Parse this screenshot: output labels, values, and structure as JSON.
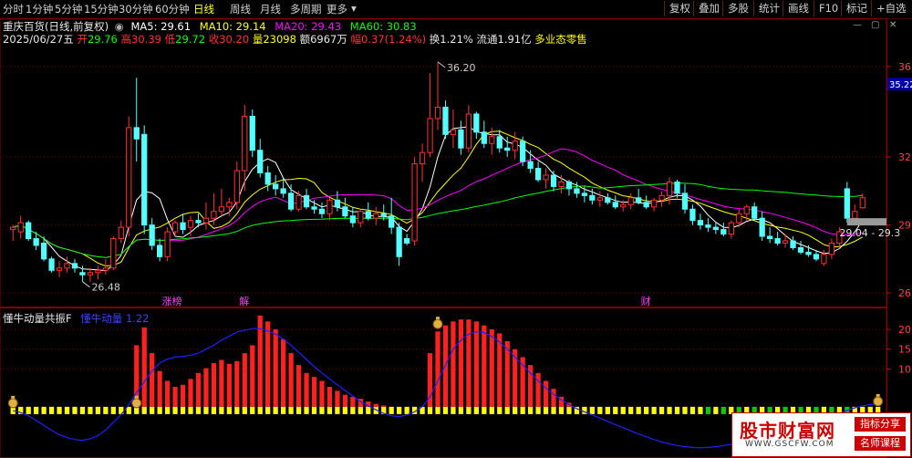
{
  "toolbar": {
    "timeframes": [
      "分时",
      "1分钟",
      "5分钟",
      "15分钟",
      "30分钟",
      "60分钟",
      "日线",
      "周线",
      "月线",
      "多周期",
      "更多"
    ],
    "active": "日线",
    "right_buttons": [
      "复权",
      "叠加",
      "多股",
      "统计",
      "画线",
      "F10",
      "标记",
      "+自选"
    ],
    "icons": [
      "minus-icon",
      "restore-icon",
      "close-icon"
    ]
  },
  "stock": {
    "name": "重庆百货(日线,前复权)",
    "ma5": "MA5: 29.61",
    "ma10": "MA10: 29.14",
    "ma20": "MA20: 29.43",
    "ma60": "MA60: 30.83",
    "date": "2025/06/27五",
    "open_lbl": "开",
    "open": "29.76",
    "high_lbl": "高",
    "high": "30.39",
    "low_lbl": "低",
    "low": "29.72",
    "close_lbl": "收",
    "close": "30.20",
    "vol_lbl": "量",
    "vol": "23098",
    "amt_lbl": "额",
    "amt": "6967万",
    "chg_lbl": "幅",
    "chg": "0.37(1.24%)",
    "turn": "换1.21%",
    "float": "流通1.91亿",
    "sector": "多业态零售"
  },
  "colors": {
    "up": "#ff3232",
    "down": "#54ffff",
    "ma5": "#ffffff",
    "ma10": "#ffff00",
    "ma20": "#ff00ff",
    "ma60": "#00ff00",
    "grid": "#800000",
    "sub_bar": "#ff2020",
    "sub_line": "#2020ff",
    "sub_base": "#ffff00"
  },
  "chart_data": [
    {
      "type": "candlestick",
      "y_ticks": [
        "36",
        "32",
        "29",
        "26"
      ],
      "ylim": [
        25.4,
        37.0
      ],
      "price_tag": "35.22",
      "annotations": {
        "high": "36.20",
        "low": "26.48",
        "range_label": "29.04 - 29.3"
      },
      "event_labels": [
        "涨榜",
        "解",
        "财"
      ],
      "candles": [
        [
          28.8,
          29.0,
          28.3,
          28.9
        ],
        [
          28.7,
          29.4,
          28.4,
          29.1
        ],
        [
          29.1,
          29.2,
          28.3,
          28.4
        ],
        [
          28.4,
          28.7,
          27.9,
          28.1
        ],
        [
          28.2,
          28.5,
          27.4,
          27.5
        ],
        [
          27.5,
          27.6,
          26.9,
          27.0
        ],
        [
          27.0,
          27.4,
          26.7,
          27.1
        ],
        [
          27.1,
          27.6,
          26.9,
          27.3
        ],
        [
          27.3,
          27.5,
          26.9,
          27.1
        ],
        [
          26.9,
          27.2,
          26.5,
          26.8
        ],
        [
          26.8,
          27.1,
          26.5,
          26.9
        ],
        [
          26.9,
          27.2,
          26.6,
          27.0
        ],
        [
          27.0,
          27.5,
          26.8,
          27.1
        ],
        [
          27.1,
          28.5,
          27.0,
          28.4
        ],
        [
          28.4,
          29.2,
          28.2,
          28.9
        ],
        [
          28.9,
          33.8,
          28.5,
          33.3
        ],
        [
          33.3,
          35.5,
          31.8,
          32.8
        ],
        [
          33.0,
          33.4,
          28.6,
          29.0
        ],
        [
          29.0,
          29.3,
          27.9,
          28.1
        ],
        [
          28.1,
          28.4,
          27.4,
          27.6
        ],
        [
          27.6,
          28.9,
          27.4,
          28.7
        ],
        [
          28.7,
          29.2,
          28.5,
          29.1
        ],
        [
          29.1,
          29.5,
          28.6,
          28.8
        ],
        [
          28.9,
          29.4,
          28.5,
          29.2
        ],
        [
          29.2,
          29.5,
          28.9,
          29.1
        ],
        [
          29.1,
          30.0,
          28.8,
          29.3
        ],
        [
          29.3,
          30.4,
          29.0,
          29.6
        ],
        [
          29.6,
          30.6,
          29.4,
          29.8
        ],
        [
          29.8,
          30.2,
          29.4,
          30.0
        ],
        [
          30.0,
          31.8,
          29.7,
          31.4
        ],
        [
          31.4,
          34.3,
          30.5,
          33.8
        ],
        [
          33.8,
          34.1,
          32.0,
          32.3
        ],
        [
          32.3,
          32.8,
          31.1,
          31.3
        ],
        [
          31.3,
          31.6,
          30.5,
          30.8
        ],
        [
          30.8,
          31.2,
          30.3,
          30.6
        ],
        [
          30.6,
          31.1,
          30.2,
          30.4
        ],
        [
          30.4,
          30.8,
          29.6,
          29.7
        ],
        [
          29.7,
          30.5,
          29.6,
          30.3
        ],
        [
          30.3,
          30.6,
          29.7,
          29.8
        ],
        [
          29.8,
          30.1,
          29.5,
          29.7
        ],
        [
          29.7,
          30.0,
          29.3,
          29.5
        ],
        [
          29.5,
          30.2,
          29.2,
          30.1
        ],
        [
          30.1,
          30.5,
          29.6,
          29.8
        ],
        [
          29.8,
          30.2,
          29.3,
          29.4
        ],
        [
          29.4,
          29.8,
          28.9,
          29.1
        ],
        [
          29.1,
          29.7,
          28.9,
          29.6
        ],
        [
          29.6,
          30.0,
          29.2,
          29.3
        ],
        [
          29.3,
          29.8,
          29.0,
          29.5
        ],
        [
          29.5,
          29.9,
          29.2,
          29.4
        ],
        [
          29.4,
          30.2,
          28.6,
          28.9
        ],
        [
          28.9,
          29.1,
          27.2,
          27.6
        ],
        [
          28.4,
          28.6,
          28.1,
          28.2
        ],
        [
          28.3,
          32.0,
          28.1,
          31.7
        ],
        [
          31.7,
          32.6,
          30.9,
          32.2
        ],
        [
          32.2,
          35.7,
          32.0,
          33.7
        ],
        [
          33.7,
          36.2,
          33.2,
          34.2
        ],
        [
          34.2,
          34.5,
          32.8,
          33.0
        ],
        [
          33.0,
          34.1,
          32.4,
          33.2
        ],
        [
          33.2,
          33.6,
          32.1,
          32.4
        ],
        [
          32.4,
          34.3,
          32.2,
          33.9
        ],
        [
          33.9,
          34.0,
          32.8,
          33.1
        ],
        [
          33.1,
          33.6,
          32.4,
          32.6
        ],
        [
          32.6,
          33.3,
          32.1,
          32.9
        ],
        [
          32.9,
          33.2,
          32.2,
          32.4
        ],
        [
          32.4,
          32.9,
          32.0,
          32.3
        ],
        [
          32.3,
          33.1,
          31.9,
          32.7
        ],
        [
          32.7,
          32.9,
          31.6,
          31.8
        ],
        [
          31.8,
          32.3,
          31.3,
          31.5
        ],
        [
          31.5,
          31.8,
          30.9,
          31.0
        ],
        [
          31.0,
          31.5,
          30.6,
          31.2
        ],
        [
          31.2,
          31.4,
          30.5,
          30.7
        ],
        [
          30.7,
          31.2,
          30.4,
          30.9
        ],
        [
          30.9,
          31.0,
          30.3,
          30.6
        ],
        [
          30.6,
          30.9,
          30.2,
          30.4
        ],
        [
          30.4,
          30.7,
          30.0,
          30.3
        ],
        [
          30.3,
          30.6,
          29.9,
          30.1
        ],
        [
          30.1,
          30.5,
          29.8,
          30.2
        ],
        [
          30.2,
          30.4,
          29.9,
          30.0
        ],
        [
          30.0,
          30.3,
          29.7,
          29.8
        ],
        [
          29.8,
          30.1,
          29.6,
          29.9
        ],
        [
          29.9,
          30.4,
          29.7,
          30.2
        ],
        [
          30.2,
          30.6,
          29.9,
          30.0
        ],
        [
          30.0,
          30.3,
          29.7,
          29.8
        ],
        [
          29.8,
          30.2,
          29.6,
          30.1
        ],
        [
          30.1,
          30.5,
          29.8,
          30.3
        ],
        [
          30.3,
          31.1,
          29.9,
          30.9
        ],
        [
          30.9,
          31.0,
          30.2,
          30.4
        ],
        [
          30.4,
          30.8,
          29.5,
          29.7
        ],
        [
          29.7,
          29.9,
          29.0,
          29.2
        ],
        [
          29.2,
          29.5,
          28.8,
          29.0
        ],
        [
          29.0,
          29.3,
          28.7,
          28.9
        ],
        [
          28.9,
          29.1,
          28.6,
          28.8
        ],
        [
          28.8,
          29.1,
          28.5,
          28.6
        ],
        [
          28.6,
          29.2,
          28.4,
          29.1
        ],
        [
          29.1,
          29.7,
          28.9,
          29.5
        ],
        [
          29.5,
          29.9,
          29.2,
          29.8
        ],
        [
          29.8,
          30.0,
          29.2,
          29.3
        ],
        [
          29.3,
          29.6,
          28.3,
          28.5
        ],
        [
          28.5,
          28.9,
          28.2,
          28.4
        ],
        [
          28.4,
          28.7,
          28.1,
          28.2
        ],
        [
          28.2,
          28.6,
          28.0,
          28.3
        ],
        [
          28.3,
          28.5,
          27.9,
          28.0
        ],
        [
          28.0,
          28.3,
          27.7,
          27.8
        ],
        [
          27.8,
          28.1,
          27.6,
          27.7
        ],
        [
          27.7,
          27.9,
          27.4,
          27.5
        ],
        [
          27.3,
          27.9,
          27.2,
          27.7
        ],
        [
          27.7,
          28.4,
          27.5,
          28.2
        ],
        [
          28.2,
          28.9,
          28.0,
          28.7
        ],
        [
          30.6,
          30.9,
          29.1,
          29.3
        ],
        [
          29.3,
          29.9,
          29.0,
          29.6
        ],
        [
          29.76,
          30.39,
          29.72,
          30.2
        ]
      ]
    },
    {
      "type": "bar+line",
      "title": "懂牛动量共振F",
      "line_label": "懂牛动量",
      "line_value": "1.22",
      "y_ticks": [
        "20",
        "15",
        "10"
      ],
      "ylim": [
        -12,
        23
      ],
      "bars": [
        0,
        0,
        0,
        0,
        0,
        0,
        0,
        0,
        0,
        0,
        0,
        0,
        0,
        0,
        0,
        0,
        16,
        20.5,
        14,
        9.5,
        7,
        5.5,
        6,
        7.5,
        9,
        10.2,
        11.5,
        12.3,
        11.3,
        12,
        14,
        16,
        23.5,
        22,
        20,
        17.5,
        14,
        11,
        9,
        8,
        7,
        5.5,
        4.5,
        3.5,
        3,
        2.5,
        1.8,
        1.2,
        0.8,
        0.5,
        0,
        0,
        0,
        0,
        14,
        19.5,
        21,
        22,
        22.5,
        22.5,
        22,
        21,
        20,
        19,
        17,
        15,
        13,
        11,
        9,
        7,
        5,
        3,
        1.5,
        0,
        0,
        0,
        0,
        0,
        0,
        0,
        0,
        0,
        0,
        0,
        0,
        0,
        0,
        0,
        0,
        0,
        0,
        0,
        0,
        0,
        0,
        0,
        0,
        0,
        0,
        0,
        0,
        0,
        0,
        0,
        0,
        0,
        0,
        0,
        0,
        0,
        0,
        0,
        0
      ],
      "line": [
        -0.5,
        -1,
        -1.8,
        -3,
        -4.2,
        -5.5,
        -6.6,
        -7.3,
        -7.8,
        -8,
        -7.6,
        -6.8,
        -5.4,
        -3.5,
        -1.5,
        1,
        4,
        6.8,
        9.5,
        11.5,
        12.5,
        13,
        13.2,
        13.5,
        14,
        15,
        16,
        17.3,
        18.3,
        19.3,
        19.8,
        20.2,
        20.2,
        19.6,
        18.8,
        17.6,
        16,
        14.2,
        12.4,
        10.6,
        9,
        7.5,
        6,
        4.6,
        3.2,
        1.8,
        0.7,
        -0.3,
        -1.2,
        -1.8,
        -2,
        -1.6,
        -0.8,
        0.5,
        3,
        7,
        11,
        15,
        17.3,
        18.8,
        19.4,
        19.2,
        18.2,
        16.8,
        15,
        13,
        11,
        9,
        7,
        5.2,
        3.6,
        2.2,
        1,
        0,
        -0.8,
        -1.6,
        -2.4,
        -3.2,
        -4,
        -4.8,
        -5.6,
        -6.4,
        -7.1,
        -7.8,
        -8.4,
        -8.9,
        -9.3,
        -9.6,
        -9.8,
        -9.9,
        -9.8,
        -9.6,
        -9.3,
        -9.0,
        -8.6,
        -8.2,
        -7.8,
        -7.3,
        -6.8,
        -6.3,
        -5.8,
        -5.2,
        -4.6,
        -4.0,
        -3.3,
        -2.6,
        -1.9,
        -1.2,
        -0.5,
        0.2,
        0.7,
        1.0,
        1.22
      ],
      "markers": [
        16,
        55,
        112,
        0
      ],
      "marker_icon": "money-bag-icon"
    }
  ],
  "watermark": {
    "title": "股市财富网",
    "url": "WWW.GSCFW.COM",
    "tag1": "指标分享",
    "tag2": "名师课程"
  }
}
